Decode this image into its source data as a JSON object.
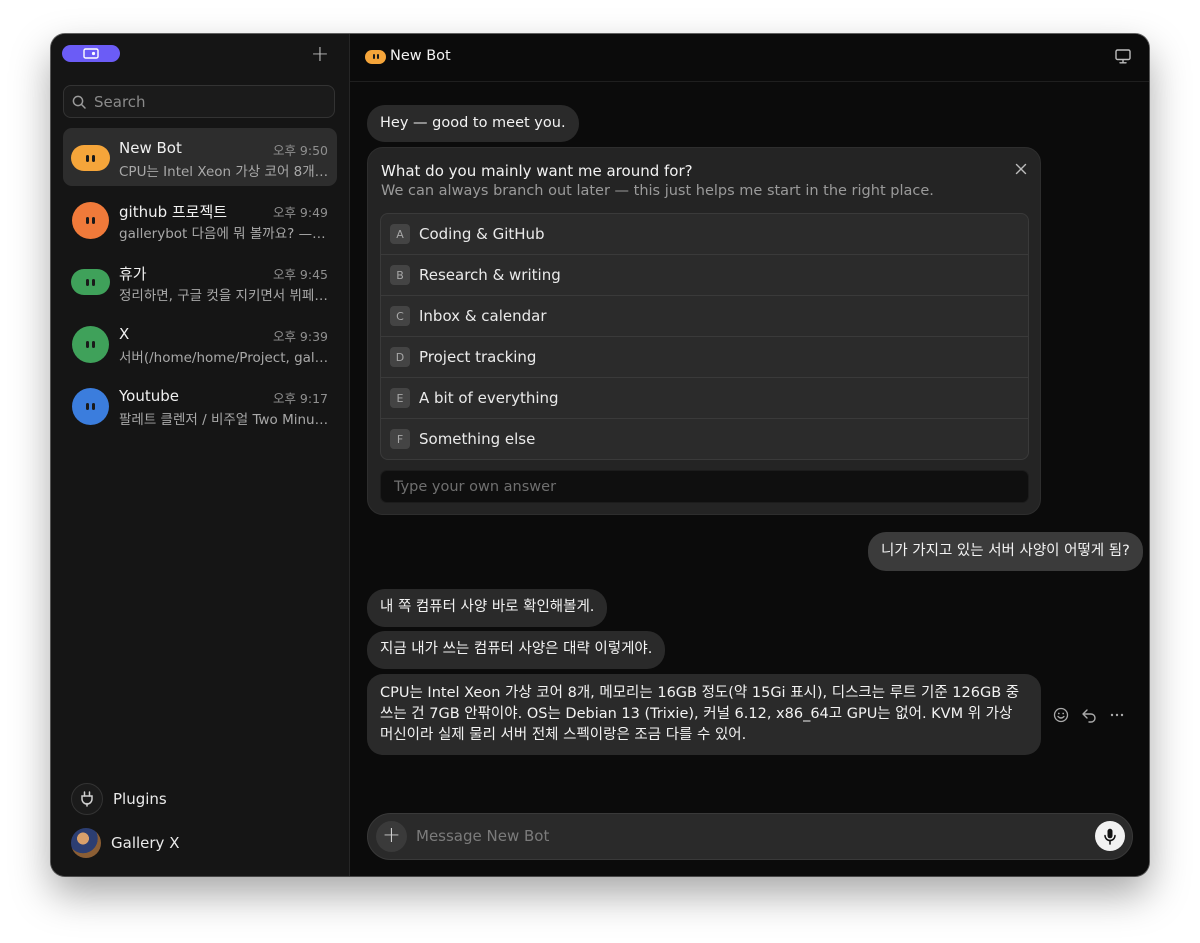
{
  "sidebar": {
    "search_placeholder": "Search",
    "chats": [
      {
        "name": "New Bot",
        "time": "오후 9:50",
        "preview": "CPU는 Intel Xeon 가상 코어 8개, ...",
        "color": "#f5a53a"
      },
      {
        "name": "github 프로젝트",
        "time": "오후 9:49",
        "preview": "gallerybot 다음에 뭐 볼까요? — A...",
        "color": "#f07a3a"
      },
      {
        "name": "휴가",
        "time": "오후 9:45",
        "preview": "정리하면, 구글 컷을 지키면서 뷔페 ...",
        "color": "#3fa15a"
      },
      {
        "name": "X",
        "time": "오후 9:39",
        "preview": "서버(/home/home/Project, gall...",
        "color": "#3fa15a"
      },
      {
        "name": "Youtube",
        "time": "오후 9:17",
        "preview": "팔레트 클렌저 / 비주얼 Two Minut...",
        "color": "#3b7ddd"
      }
    ],
    "plugins_label": "Plugins",
    "user_name": "Gallery X",
    "pill_color": "#6b5cf6"
  },
  "header": {
    "title": "New Bot"
  },
  "conversation": {
    "greeting": "Hey — good to meet you.",
    "question": {
      "title": "What do you mainly want me around for?",
      "subtitle": "We can always branch out later — this just helps me start in the right place.",
      "options": [
        {
          "key": "A",
          "label": "Coding & GitHub"
        },
        {
          "key": "B",
          "label": "Research & writing"
        },
        {
          "key": "C",
          "label": "Inbox & calendar"
        },
        {
          "key": "D",
          "label": "Project tracking"
        },
        {
          "key": "E",
          "label": "A bit of everything"
        },
        {
          "key": "F",
          "label": "Something else"
        }
      ],
      "own_answer_placeholder": "Type your own answer"
    },
    "user_message": "니가 가지고 있는 서버 사양이 어떻게 됨?",
    "bot_reply_1": "내 쪽 컴퓨터 사양 바로 확인해볼게.",
    "bot_reply_2": "지금 내가 쓰는 컴퓨터 사양은 대략 이렇게야.",
    "bot_reply_3": "CPU는 Intel Xeon 가상 코어 8개, 메모리는 16GB 정도(약 15Gi 표시), 디스크는 루트 기준 126GB 중 쓰는 건 7GB 안팎이야. OS는 Debian 13 (Trixie), 커널 6.12, x86_64고 GPU는 없어. KVM 위 가상 머신이라 실제 물리 서버 전체 스펙이랑은 조금 다를 수 있어."
  },
  "composer": {
    "placeholder": "Message New Bot"
  }
}
